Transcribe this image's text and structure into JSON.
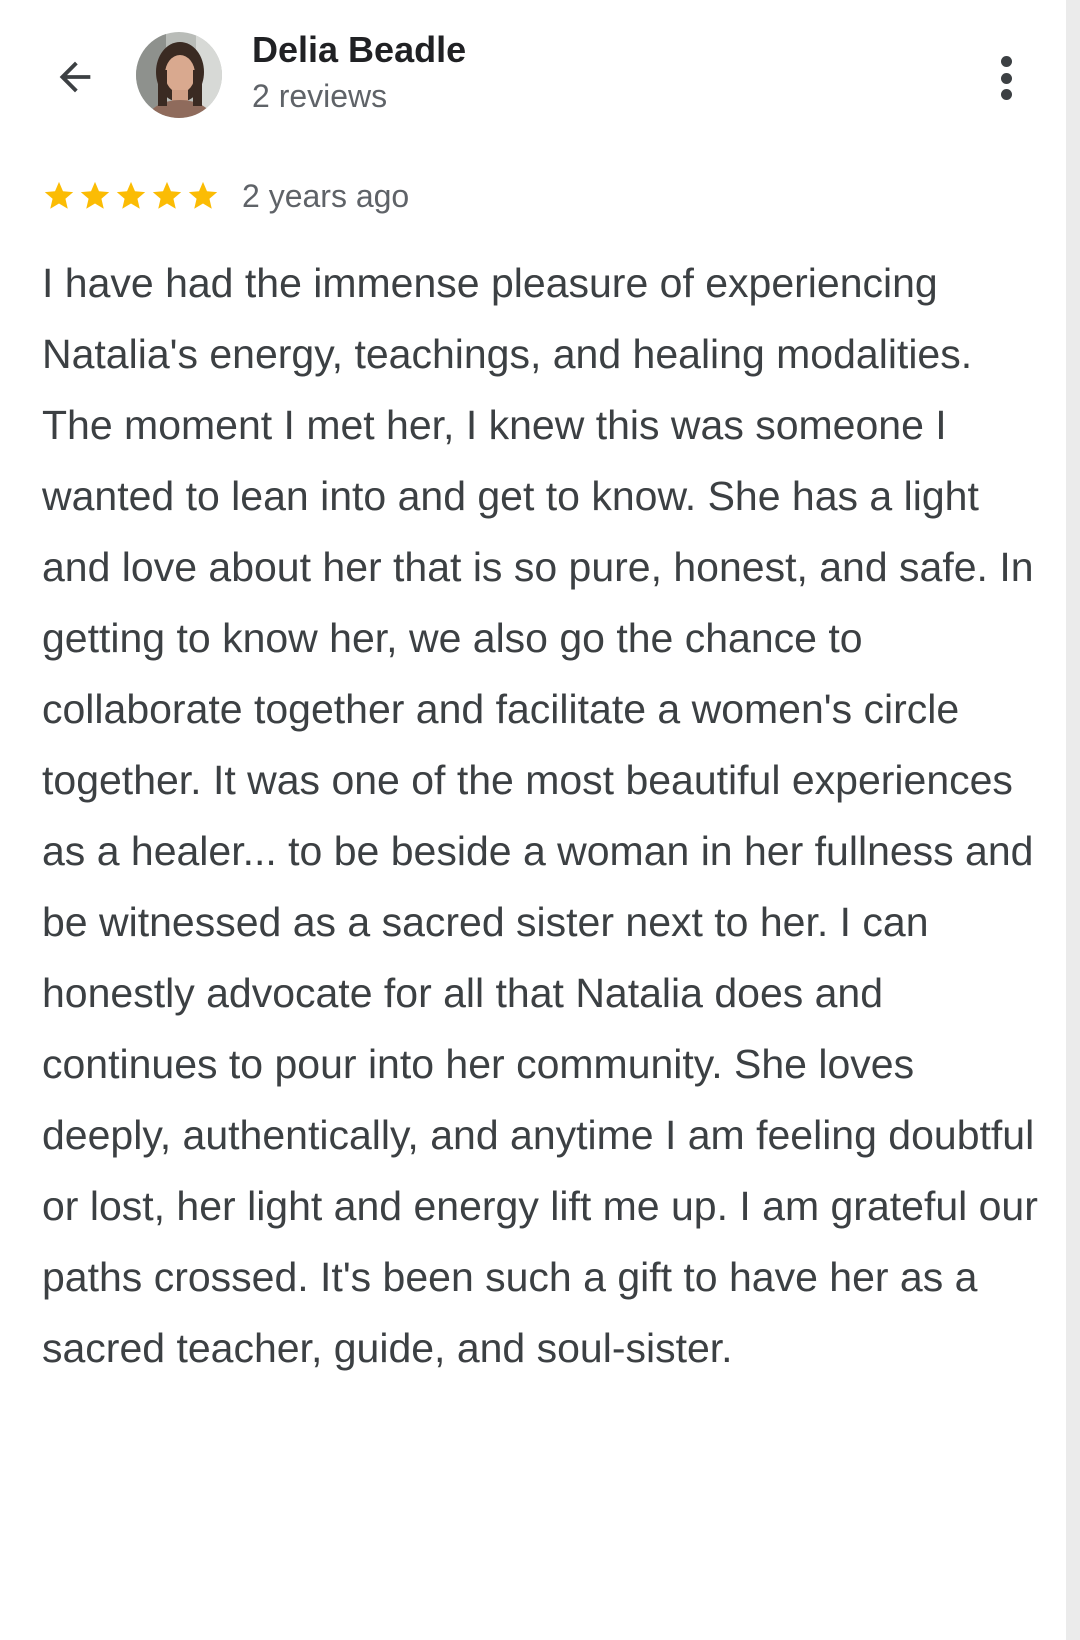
{
  "header": {
    "back_icon": "arrow-back-icon",
    "avatar_icon": "avatar",
    "reviewer_name": "Delia Beadle",
    "reviewer_reviews": "2 reviews",
    "more_icon": "more-vertical-icon"
  },
  "review": {
    "rating": 5,
    "rating_max": 5,
    "star_icon": "star-icon",
    "star_color": "#fbbc04",
    "time_ago": "2 years ago",
    "text": "I have had the immense pleasure of experiencing Natalia's energy, teachings, and healing modalities. The moment I met her, I knew this was someone I wanted to lean into and get to know. She has a light and love about her that is so pure, honest, and safe. In getting to know her, we also go the chance to collaborate together and facilitate a women's circle together. It was one of the most beautiful experiences as a healer... to be beside a woman in her fullness and be witnessed as a sacred sister next to her. I can honestly advocate for all that Natalia does and continues to pour into her community. She loves deeply, authentically, and anytime I am feeling doubtful or lost, her light and energy lift me up. I am grateful our paths crossed. It's been such a gift to have her as a sacred teacher, guide, and soul-sister."
  }
}
